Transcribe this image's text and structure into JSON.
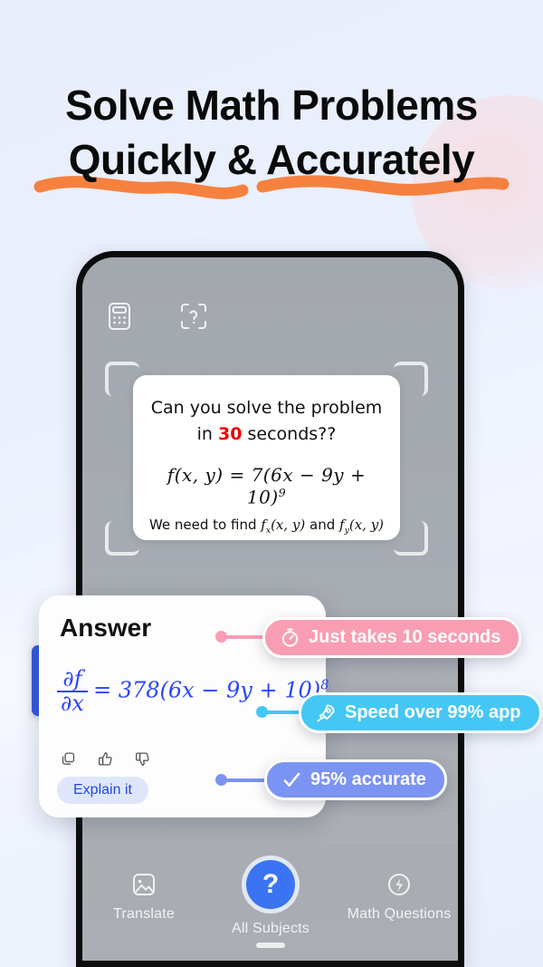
{
  "headline": {
    "line1": "Solve Math Problems",
    "line2": "Quickly & Accurately",
    "underline_color": "#f6813f"
  },
  "colors": {
    "background": "#e6ecfb",
    "accent_blue": "#3b74f2",
    "answer_blue": "#2a46ff",
    "badge_pink": "#f99db3",
    "badge_cyan": "#45c7f5",
    "badge_blue": "#7b93f2",
    "red_number": "#ee0000"
  },
  "phone": {
    "top_icons": [
      {
        "name": "calculator-icon"
      },
      {
        "name": "scan-question-icon"
      }
    ],
    "problem_card": {
      "question_line1": "Can you solve the problem",
      "question_line2_pre": "in ",
      "question_seconds": "30",
      "question_line2_post": " seconds??",
      "formula": "f(x, y) = 7(6x − 9y + 10)⁹",
      "formula_parts": {
        "lhs": "f",
        "args": "(x, y)",
        "eq": " = 7(6x − 9y + 10)",
        "exp": "9"
      },
      "note_pre": "We need to find ",
      "note_fx": "f",
      "note_fx_sub": "x",
      "note_fx_args": "(x, y)",
      "note_mid": " and ",
      "note_fy": "f",
      "note_fy_sub": "y",
      "note_fy_args": "(x, y)"
    },
    "nav": [
      {
        "label": "Translate",
        "icon": "image-icon",
        "active": false
      },
      {
        "label": "All Subjects",
        "icon": "question-mark-icon",
        "active": true
      },
      {
        "label": "Math Questions",
        "icon": "lightning-bolt-icon",
        "active": false
      }
    ]
  },
  "answer_card": {
    "title": "Answer",
    "formula": {
      "numerator": "∂f",
      "denominator": "∂x",
      "body": "= 378(6x − 9y + 10)",
      "exponent": "8"
    },
    "actions": [
      {
        "name": "copy-icon"
      },
      {
        "name": "thumbs-up-icon"
      },
      {
        "name": "thumbs-down-icon"
      }
    ],
    "explain_button": "Explain it"
  },
  "badges": [
    {
      "label": "Just takes 10 seconds",
      "icon": "timer-icon",
      "color": "#f99db3"
    },
    {
      "label": "Speed over 99% app",
      "icon": "rocket-icon",
      "color": "#45c7f5"
    },
    {
      "label": "95% accurate",
      "icon": "check-icon",
      "color": "#7b93f2"
    }
  ]
}
